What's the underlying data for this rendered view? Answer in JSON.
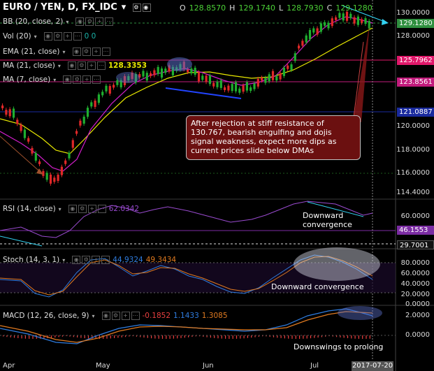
{
  "header": {
    "symbol": "EURO / YEN, D, FX_IDC",
    "ohlc": [
      {
        "k": "O",
        "v": "128.8570"
      },
      {
        "k": "H",
        "v": "129.1740"
      },
      {
        "k": "L",
        "v": "128.7930"
      },
      {
        "k": "C",
        "v": "129.1280"
      }
    ]
  },
  "indicators": {
    "bb": "BB (20, close, 2)",
    "vol": "Vol (20)",
    "vol_values": "0  0",
    "ema": "EMA (21, close)",
    "ma21": "MA (21, close)",
    "ma21_value": "128.3353",
    "ma7": "MA (7, close)",
    "rsi": "RSI (14, close)",
    "rsi_value": "62.0342",
    "stoch": "Stoch (14, 3, 1)",
    "stoch_k": "44.9324",
    "stoch_d": "49.3434",
    "macd": "MACD (12, 26, close, 9)",
    "macd_v1": "-0.1852",
    "macd_v2": "1.1433",
    "macd_v3": "1.3085"
  },
  "price_labels": [
    {
      "text": "129.1280",
      "bg": "#2f8f3f"
    },
    {
      "text": "125.7962",
      "bg": "#e0186a"
    },
    {
      "text": "123.8561",
      "bg": "#c21b7c"
    },
    {
      "text": "121.0887",
      "bg": "#1a2a9e"
    },
    {
      "text": "46.1553",
      "bg": "#7b2ca3"
    },
    {
      "text": "29.7001",
      "bg": "#111111"
    }
  ],
  "axis_ticks": {
    "price": [
      "130.0000",
      "128.0000",
      "126.0000",
      "124.0000",
      "122.0000",
      "120.0000",
      "118.0000",
      "116.0000",
      "114.4000"
    ],
    "rsi": [
      "60.0000"
    ],
    "stoch": [
      "80.0000",
      "60.0000",
      "40.0000",
      "20.0000",
      "0.0000"
    ],
    "macd": [
      "2.0000",
      "0.0000"
    ]
  },
  "x_ticks": [
    "Apr",
    "May",
    "Jun",
    "Jul"
  ],
  "current_date": "2017-07-20",
  "annotations": {
    "note": "After rejection at stiff resistance of 130.767, bearish engulfing and dojis signal weakness, expect more dips as current prices slide below DMAs",
    "rsi_note": "Downward convergence",
    "stoch_note": "Downward convergence",
    "macd_note": "Downswings to prolong"
  }
}
